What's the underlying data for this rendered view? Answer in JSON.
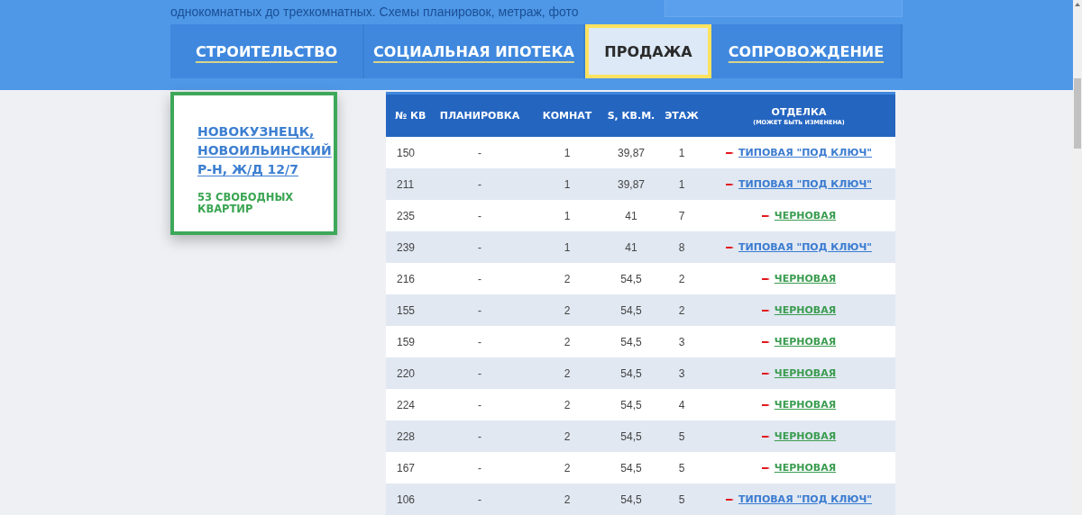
{
  "intro_text": "однокомнатных до трехкомнатных. Схемы планировок, метраж, фото",
  "tabs": [
    {
      "label": "СТРОИТЕЛЬСТВО",
      "selected": false
    },
    {
      "label": "СОЦИАЛЬНАЯ ИПОТЕКА",
      "selected": false
    },
    {
      "label": "ПРОДАЖА",
      "selected": true
    },
    {
      "label": "СОПРОВОЖДЕНИЕ",
      "selected": false
    }
  ],
  "house_card": {
    "title": "НОВОКУЗНЕЦК, НОВОИЛЬИНСКИЙ Р-Н, Ж/Д 12/7",
    "free_count": "53 СВОБОДНЫХ КВАРТИР"
  },
  "table": {
    "columns": [
      "№ КВ",
      "ПЛАНИРОВКА",
      "КОМНАТ",
      "S, КВ.М.",
      "ЭТАЖ"
    ],
    "finish_column": {
      "label": "ОТДЕЛКА",
      "note": "(МОЖЕТ БЫТЬ ИЗМЕНЕНА)"
    },
    "rows": [
      {
        "number": "150",
        "plan": "-",
        "rooms": "1",
        "area": "39,87",
        "floor": "1",
        "finish": {
          "kind": "turnkey",
          "label": "ТИПОВАЯ \"ПОД КЛЮЧ\""
        }
      },
      {
        "number": "211",
        "plan": "-",
        "rooms": "1",
        "area": "39,87",
        "floor": "1",
        "finish": {
          "kind": "turnkey",
          "label": "ТИПОВАЯ \"ПОД КЛЮЧ\""
        }
      },
      {
        "number": "235",
        "plan": "-",
        "rooms": "1",
        "area": "41",
        "floor": "7",
        "finish": {
          "kind": "rough",
          "label": "ЧЕРНОВАЯ"
        }
      },
      {
        "number": "239",
        "plan": "-",
        "rooms": "1",
        "area": "41",
        "floor": "8",
        "finish": {
          "kind": "turnkey",
          "label": "ТИПОВАЯ \"ПОД КЛЮЧ\""
        }
      },
      {
        "number": "216",
        "plan": "-",
        "rooms": "2",
        "area": "54,5",
        "floor": "2",
        "finish": {
          "kind": "rough",
          "label": "ЧЕРНОВАЯ"
        }
      },
      {
        "number": "155",
        "plan": "-",
        "rooms": "2",
        "area": "54,5",
        "floor": "2",
        "finish": {
          "kind": "rough",
          "label": "ЧЕРНОВАЯ"
        }
      },
      {
        "number": "159",
        "plan": "-",
        "rooms": "2",
        "area": "54,5",
        "floor": "3",
        "finish": {
          "kind": "rough",
          "label": "ЧЕРНОВАЯ"
        }
      },
      {
        "number": "220",
        "plan": "-",
        "rooms": "2",
        "area": "54,5",
        "floor": "3",
        "finish": {
          "kind": "rough",
          "label": "ЧЕРНОВАЯ"
        }
      },
      {
        "number": "224",
        "plan": "-",
        "rooms": "2",
        "area": "54,5",
        "floor": "4",
        "finish": {
          "kind": "rough",
          "label": "ЧЕРНОВАЯ"
        }
      },
      {
        "number": "228",
        "plan": "-",
        "rooms": "2",
        "area": "54,5",
        "floor": "5",
        "finish": {
          "kind": "rough",
          "label": "ЧЕРНОВАЯ"
        }
      },
      {
        "number": "167",
        "plan": "-",
        "rooms": "2",
        "area": "54,5",
        "floor": "5",
        "finish": {
          "kind": "rough",
          "label": "ЧЕРНОВАЯ"
        }
      },
      {
        "number": "106",
        "plan": "-",
        "rooms": "2",
        "area": "54,5",
        "floor": "5",
        "finish": {
          "kind": "turnkey",
          "label": "ТИПОВАЯ \"ПОД КЛЮЧ\""
        }
      }
    ]
  }
}
